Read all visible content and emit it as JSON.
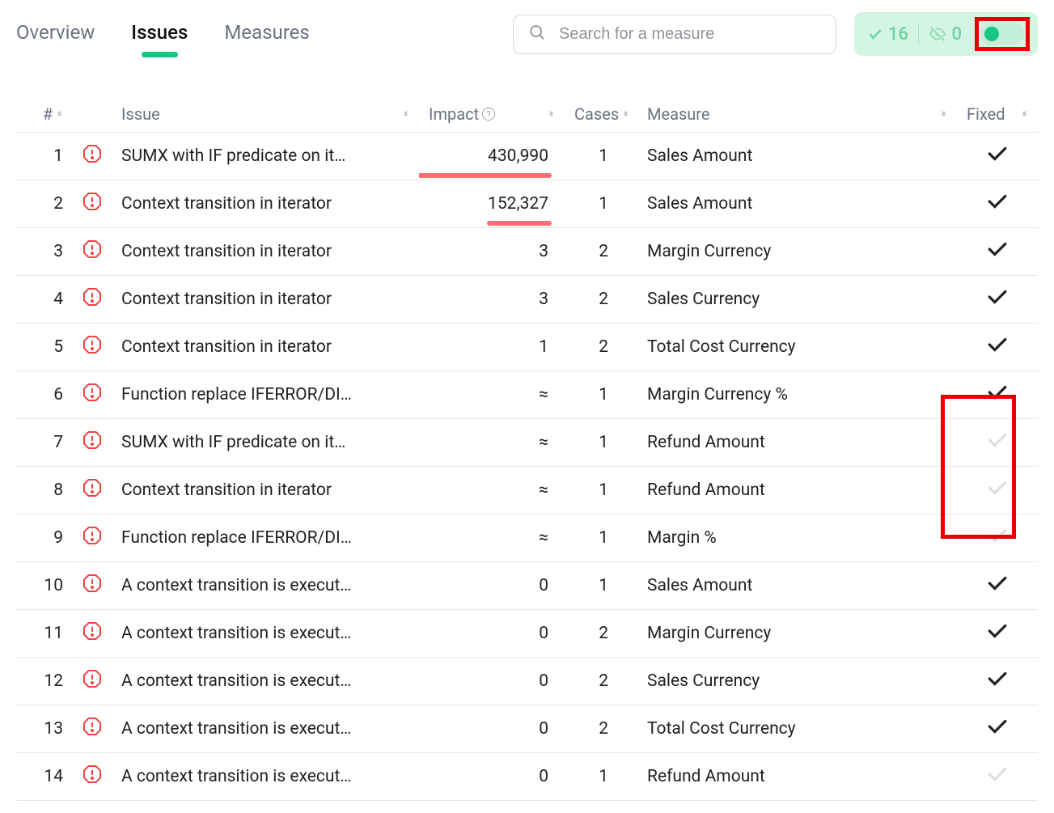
{
  "tabs": {
    "overview": "Overview",
    "issues": "Issues",
    "measures": "Measures"
  },
  "search": {
    "placeholder": "Search for a measure"
  },
  "badge": {
    "checked_count": "16",
    "hidden_count": "0"
  },
  "columns": {
    "num": "#",
    "issue": "Issue",
    "impact": "Impact",
    "cases": "Cases",
    "measure": "Measure",
    "fixed": "Fixed"
  },
  "rows": [
    {
      "n": "1",
      "issue": "SUMX with IF predicate on it…",
      "impact": "430,990",
      "ul": 180,
      "cases": "1",
      "measure": "Sales Amount",
      "fixed": true
    },
    {
      "n": "2",
      "issue": "Context transition in iterator",
      "impact": "152,327",
      "ul": 80,
      "cases": "1",
      "measure": "Sales Amount",
      "fixed": true
    },
    {
      "n": "3",
      "issue": "Context transition in iterator",
      "impact": "3",
      "cases": "2",
      "measure": "Margin Currency",
      "fixed": true
    },
    {
      "n": "4",
      "issue": "Context transition in iterator",
      "impact": "3",
      "cases": "2",
      "measure": "Sales Currency",
      "fixed": true
    },
    {
      "n": "5",
      "issue": "Context transition in iterator",
      "impact": "1",
      "cases": "2",
      "measure": "Total Cost Currency",
      "fixed": true
    },
    {
      "n": "6",
      "issue": "Function replace IFERROR/DI…",
      "impact": "≈",
      "cases": "1",
      "measure": "Margin Currency %",
      "fixed": true
    },
    {
      "n": "7",
      "issue": "SUMX with IF predicate on it…",
      "impact": "≈",
      "cases": "1",
      "measure": "Refund Amount",
      "fixed": false
    },
    {
      "n": "8",
      "issue": "Context transition in iterator",
      "impact": "≈",
      "cases": "1",
      "measure": "Refund Amount",
      "fixed": false
    },
    {
      "n": "9",
      "issue": "Function replace IFERROR/DI…",
      "impact": "≈",
      "cases": "1",
      "measure": "Margin %",
      "fixed": false
    },
    {
      "n": "10",
      "issue": "A context transition is execut…",
      "impact": "0",
      "cases": "1",
      "measure": "Sales Amount",
      "fixed": true
    },
    {
      "n": "11",
      "issue": "A context transition is execut…",
      "impact": "0",
      "cases": "2",
      "measure": "Margin Currency",
      "fixed": true
    },
    {
      "n": "12",
      "issue": "A context transition is execut…",
      "impact": "0",
      "cases": "2",
      "measure": "Sales Currency",
      "fixed": true
    },
    {
      "n": "13",
      "issue": "A context transition is execut…",
      "impact": "0",
      "cases": "2",
      "measure": "Total Cost Currency",
      "fixed": true
    },
    {
      "n": "14",
      "issue": "A context transition is execut…",
      "impact": "0",
      "cases": "1",
      "measure": "Refund Amount",
      "fixed": false
    }
  ]
}
